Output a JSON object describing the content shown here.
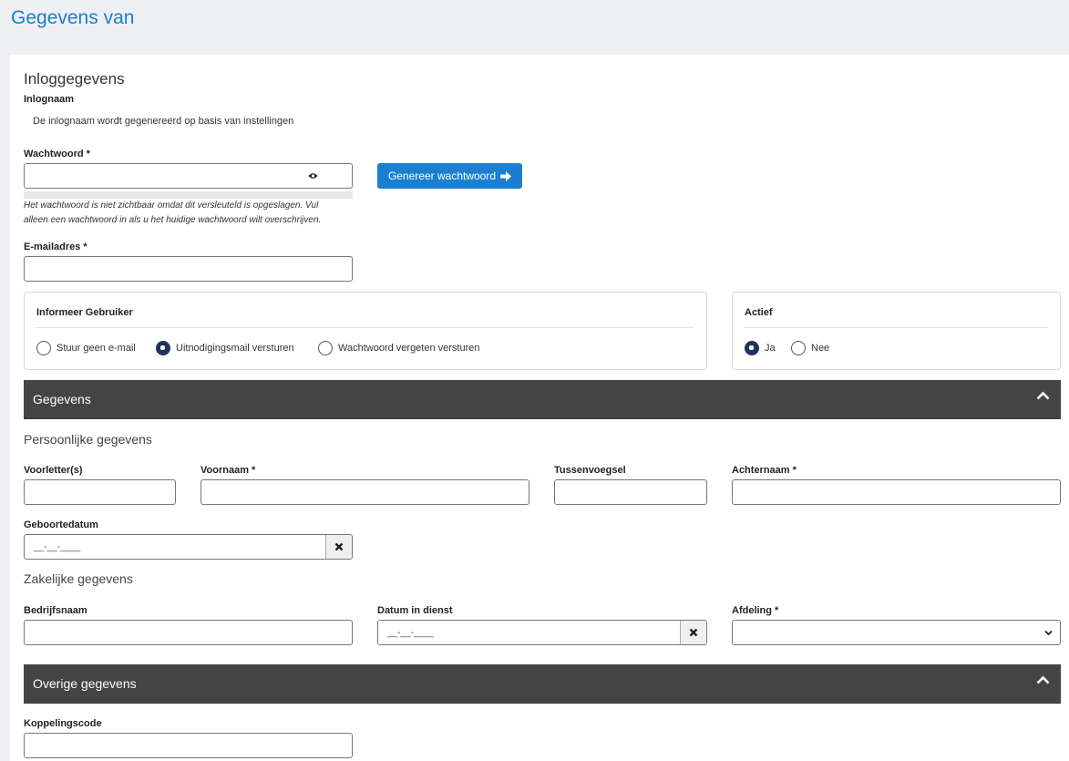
{
  "page": {
    "title": "Gegevens van"
  },
  "login": {
    "section_title": "Inloggegevens",
    "username_label": "Inlognaam",
    "username_note": "De inlognaam wordt gegenereerd op basis van instellingen",
    "password_label": "Wachtwoord *",
    "password_value": "",
    "password_help_1": "Het wachtwoord is niet zichtbaar omdat dit versleuteld is opgeslagen. Vul",
    "password_help_2": "alleen een wachtwoord in als u het huidige wachtwoord wilt overschrijven.",
    "generate_button": "Genereer wachtwoord",
    "email_label": "E-mailadres *",
    "email_value": ""
  },
  "inform": {
    "title": "Informeer Gebruiker",
    "options": [
      {
        "label": "Stuur geen e-mail",
        "checked": false
      },
      {
        "label": "Uitnodigingsmail versturen",
        "checked": true
      },
      {
        "label": "Wachtwoord vergeten versturen",
        "checked": false
      }
    ]
  },
  "active": {
    "title": "Actief",
    "options": [
      {
        "label": "Ja",
        "checked": true
      },
      {
        "label": "Nee",
        "checked": false
      }
    ]
  },
  "gegevens": {
    "bar_title": "Gegevens",
    "personal_title": "Persoonlijke gegevens",
    "initials_label": "Voorletter(s)",
    "firstname_label": "Voornaam *",
    "infix_label": "Tussenvoegsel",
    "lastname_label": "Achternaam *",
    "birthdate_label": "Geboortedatum",
    "birthdate_mask": "__-__-____",
    "business_title": "Zakelijke gegevens",
    "company_label": "Bedrijfsnaam",
    "startdate_label": "Datum in dienst",
    "startdate_mask": "__-__-____",
    "department_label": "Afdeling *",
    "department_value": ""
  },
  "other": {
    "bar_title": "Overige gegevens",
    "link_code_label": "Koppelingscode"
  },
  "colors": {
    "accent": "#1a7fd1",
    "bar": "#444444",
    "radio_checked": "#1f3558"
  },
  "icons": {
    "eye": "eye-icon",
    "arrow": "arrow-right-icon",
    "chevron": "chevron-up-icon",
    "clear": "x-icon",
    "select": "chevron-down-icon"
  }
}
